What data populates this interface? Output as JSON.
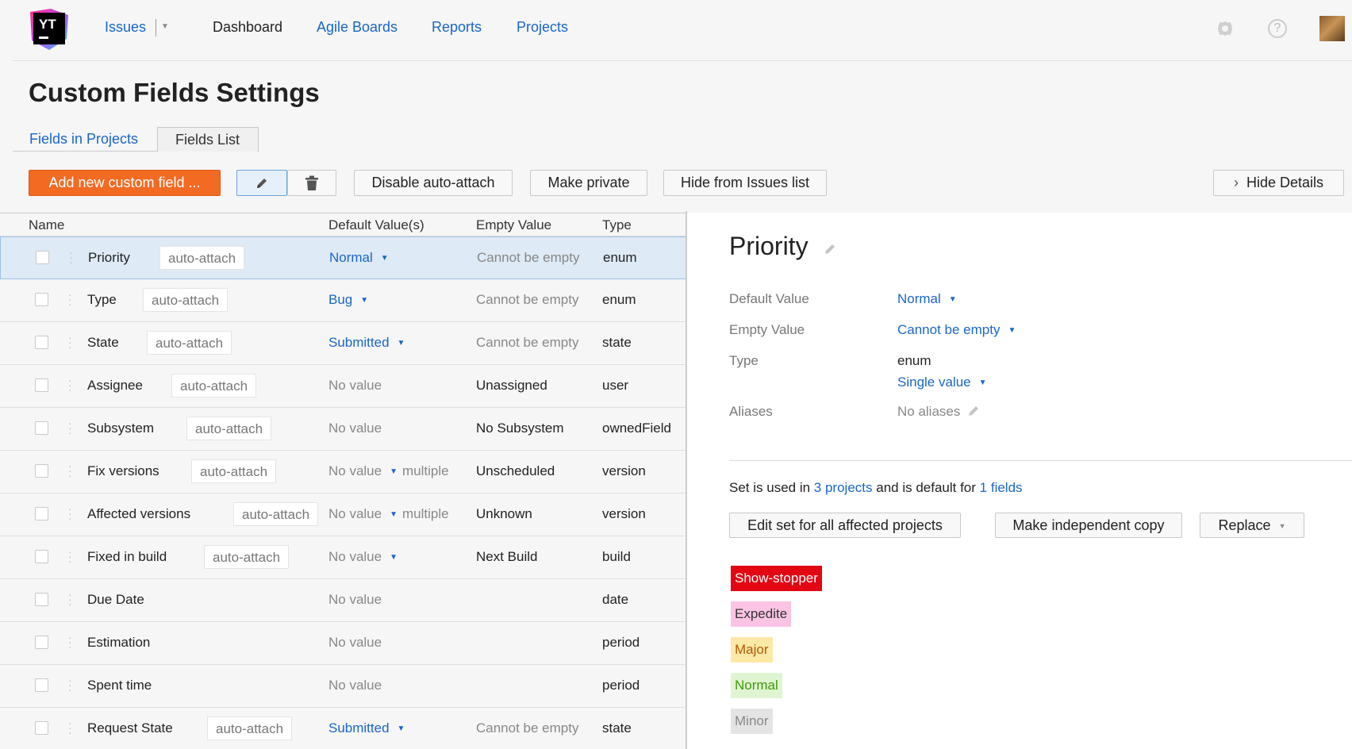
{
  "nav": {
    "issues": "Issues",
    "dashboard": "Dashboard",
    "agile_boards": "Agile Boards",
    "reports": "Reports",
    "projects": "Projects"
  },
  "logo_text": "YT",
  "help_glyph": "?",
  "page_title": "Custom Fields Settings",
  "tabs": {
    "fields_in_projects": "Fields in Projects",
    "fields_list": "Fields List"
  },
  "toolbar": {
    "add": "Add new custom field ...",
    "disable_auto_attach": "Disable auto-attach",
    "make_private": "Make private",
    "hide_from_issues": "Hide from Issues list",
    "hide_details": "Hide Details"
  },
  "columns": {
    "name": "Name",
    "default": "Default Value(s)",
    "empty": "Empty Value",
    "type": "Type"
  },
  "rows": [
    {
      "name": "Priority",
      "badge": "auto-attach",
      "default": "Normal",
      "default_style": "link",
      "multiple": "",
      "empty": "Cannot be empty",
      "empty_style": "muted",
      "type": "enum"
    },
    {
      "name": "Type",
      "badge": "auto-attach",
      "default": "Bug",
      "default_style": "link",
      "multiple": "",
      "empty": "Cannot be empty",
      "empty_style": "muted",
      "type": "enum"
    },
    {
      "name": "State",
      "badge": "auto-attach",
      "default": "Submitted",
      "default_style": "link",
      "multiple": "",
      "empty": "Cannot be empty",
      "empty_style": "muted",
      "type": "state"
    },
    {
      "name": "Assignee",
      "badge": "auto-attach",
      "default": "No value",
      "default_style": "muted",
      "multiple": "",
      "empty": "Unassigned",
      "empty_style": "plain",
      "type": "user"
    },
    {
      "name": "Subsystem",
      "badge": "auto-attach",
      "default": "No value",
      "default_style": "muted",
      "multiple": "",
      "empty": "No Subsystem",
      "empty_style": "plain",
      "type": "ownedField"
    },
    {
      "name": "Fix versions",
      "badge": "auto-attach",
      "default": "No value",
      "default_style": "muted-caret",
      "multiple": "multiple",
      "empty": "Unscheduled",
      "empty_style": "plain",
      "type": "version"
    },
    {
      "name": "Affected versions",
      "badge": "auto-attach",
      "default": "No value",
      "default_style": "muted-caret",
      "multiple": "multiple",
      "empty": "Unknown",
      "empty_style": "plain",
      "type": "version"
    },
    {
      "name": "Fixed in build",
      "badge": "auto-attach",
      "default": "No value",
      "default_style": "muted-caret",
      "multiple": "",
      "empty": "Next Build",
      "empty_style": "plain",
      "type": "build"
    },
    {
      "name": "Due Date",
      "badge": "",
      "default": "No value",
      "default_style": "muted",
      "multiple": "",
      "empty": "",
      "empty_style": "plain",
      "type": "date"
    },
    {
      "name": "Estimation",
      "badge": "",
      "default": "No value",
      "default_style": "muted",
      "multiple": "",
      "empty": "",
      "empty_style": "plain",
      "type": "period"
    },
    {
      "name": "Spent time",
      "badge": "",
      "default": "No value",
      "default_style": "muted",
      "multiple": "",
      "empty": "",
      "empty_style": "plain",
      "type": "period"
    },
    {
      "name": "Request State",
      "badge": "auto-attach",
      "default": "Submitted",
      "default_style": "link",
      "multiple": "",
      "empty": "Cannot be empty",
      "empty_style": "muted",
      "type": "state"
    }
  ],
  "detail": {
    "title": "Priority",
    "labels": {
      "default_value": "Default Value",
      "empty_value": "Empty Value",
      "type": "Type",
      "aliases": "Aliases"
    },
    "default_value": "Normal",
    "empty_value": "Cannot be empty",
    "type": "enum",
    "value_mode": "Single value",
    "aliases": "No aliases",
    "usage": {
      "prefix": "Set is used in",
      "projects_link": "3 projects",
      "middle": "and is default for",
      "fields_link": "1 fields"
    },
    "buttons": {
      "edit_set": "Edit set for all affected projects",
      "independent_copy": "Make independent copy",
      "replace": "Replace"
    },
    "values": [
      {
        "label": "Show-stopper",
        "bg": "#e30613",
        "fg": "#ffffff"
      },
      {
        "label": "Expedite",
        "bg": "#fbc4e4",
        "fg": "#333333"
      },
      {
        "label": "Major",
        "bg": "#fde9a6",
        "fg": "#b35a00"
      },
      {
        "label": "Normal",
        "bg": "#dff5d2",
        "fg": "#3f9a0a"
      },
      {
        "label": "Minor",
        "bg": "#e4e4e4",
        "fg": "#888888"
      }
    ]
  },
  "colors": {
    "accent_link": "#1a66c8",
    "primary_button": "#f36a23",
    "selected_row": "#deeaf5"
  }
}
